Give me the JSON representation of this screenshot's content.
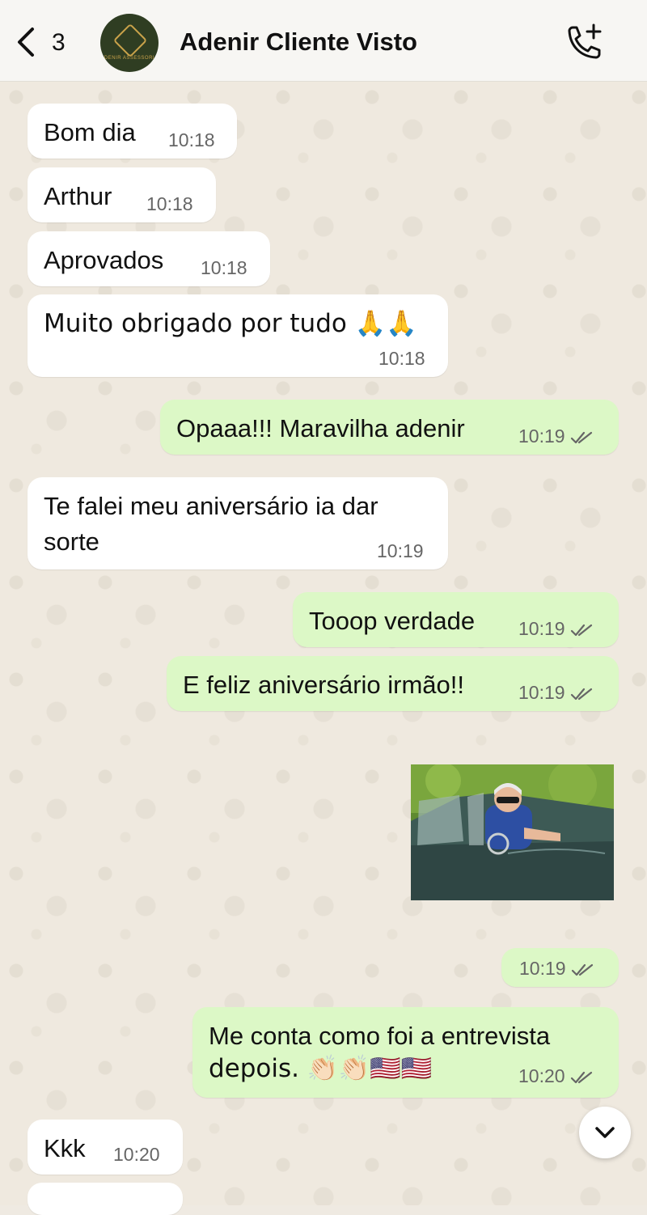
{
  "header": {
    "back_count": "3",
    "contact_name": "Adenir Cliente Visto",
    "avatar_brand": "ADENIR ASSESSORIA"
  },
  "messages": [
    {
      "dir": "in",
      "text": "Bom dia",
      "time": "10:18"
    },
    {
      "dir": "in",
      "text": "Arthur",
      "time": "10:18"
    },
    {
      "dir": "in",
      "text": "Aprovados",
      "time": "10:18"
    },
    {
      "dir": "in",
      "text": "Muito obrigado por tudo 🙏🙏",
      "time": "10:18"
    },
    {
      "dir": "out",
      "text": "Opaaa!!! Maravilha adenir",
      "time": "10:19"
    },
    {
      "dir": "in",
      "line1": "Te falei meu aniversário  ia dar",
      "line2": "sorte",
      "time": "10:19"
    },
    {
      "dir": "out",
      "text": "Tooop verdade",
      "time": "10:19"
    },
    {
      "dir": "out",
      "text": "E feliz aniversário irmão!!",
      "time": "10:19"
    },
    {
      "dir": "out",
      "type": "image",
      "time": "10:19"
    },
    {
      "dir": "out",
      "line1": "Me conta como foi a entrevista",
      "line2": "depois. 👏🏻👏🏻🇺🇸🇺🇸",
      "time": "10:20"
    },
    {
      "dir": "in",
      "text": "Kkk",
      "time": "10:20"
    }
  ],
  "colors": {
    "incoming_bubble": "#ffffff",
    "outgoing_bubble": "#dcf8c6",
    "read_ticks": "#666666"
  }
}
